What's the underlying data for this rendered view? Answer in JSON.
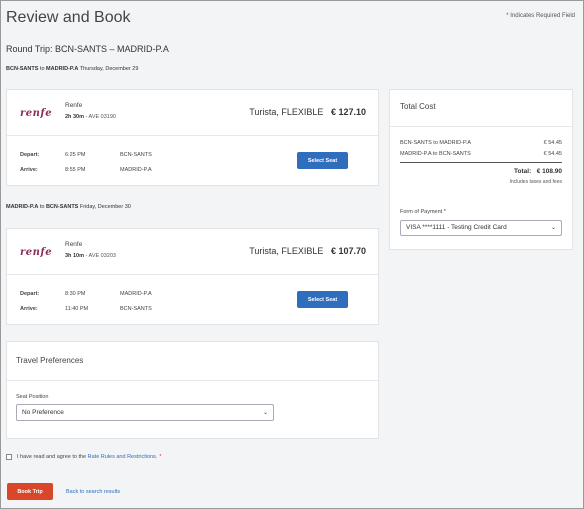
{
  "page": {
    "title": "Review and Book",
    "required_note": "* Indicates Required Field"
  },
  "trip": {
    "heading": "Round Trip: BCN-SANTS – MADRID-P.A",
    "segments": [
      {
        "from": "BCN-SANTS",
        "connector": "to",
        "to": "MADRID-P.A",
        "date": "Thursday, December 29",
        "logo": "renfe",
        "carrier": "Renfe",
        "duration": "2h 30m",
        "train": "- AVE 03190",
        "fare_class": "Turista, FLEXIBLE",
        "price": "€ 127.10",
        "depart_label": "Depart:",
        "depart_time": "6:25 PM",
        "depart_station": "BCN-SANTS",
        "arrive_label": "Arrive:",
        "arrive_time": "8:55 PM",
        "arrive_station": "MADRID-P.A",
        "seat_button": "Select Seat"
      },
      {
        "from": "MADRID-P.A",
        "connector": "to",
        "to": "BCN-SANTS",
        "date": "Friday, December 30",
        "logo": "renfe",
        "carrier": "Renfe",
        "duration": "3h 10m",
        "train": "- AVE 03203",
        "fare_class": "Turista, FLEXIBLE",
        "price": "€ 107.70",
        "depart_label": "Depart:",
        "depart_time": "8:30 PM",
        "depart_station": "MADRID-P.A",
        "arrive_label": "Arrive:",
        "arrive_time": "11:40 PM",
        "arrive_station": "BCN-SANTS",
        "seat_button": "Select Seat"
      }
    ]
  },
  "cost": {
    "title": "Total Cost",
    "lines": [
      {
        "label": "BCN-SANTS to MADRID-P.A",
        "amount": "€ 54.45"
      },
      {
        "label": "MADRID-P.A to BCN-SANTS",
        "amount": "€ 54.45"
      }
    ],
    "total_label": "Total:",
    "total_amount": "€ 108.90",
    "taxes_note": "Includes taxes and fees",
    "payment_label": "Form of Payment *",
    "payment_value": "VISA ****1111 - Testing Credit Card"
  },
  "preferences": {
    "title": "Travel Preferences",
    "seat_position_label": "Seat Position",
    "seat_position_value": "No Preference"
  },
  "agreement": {
    "text": "I have read and agree to the",
    "link": "Rate Rules and Restrictions.",
    "required": "*"
  },
  "actions": {
    "book": "Book Trip",
    "back": "Back to search results"
  },
  "colors": {
    "primary_button": "#2f6dbd",
    "book_button": "#d9472b",
    "logo": "#8a2c57"
  }
}
